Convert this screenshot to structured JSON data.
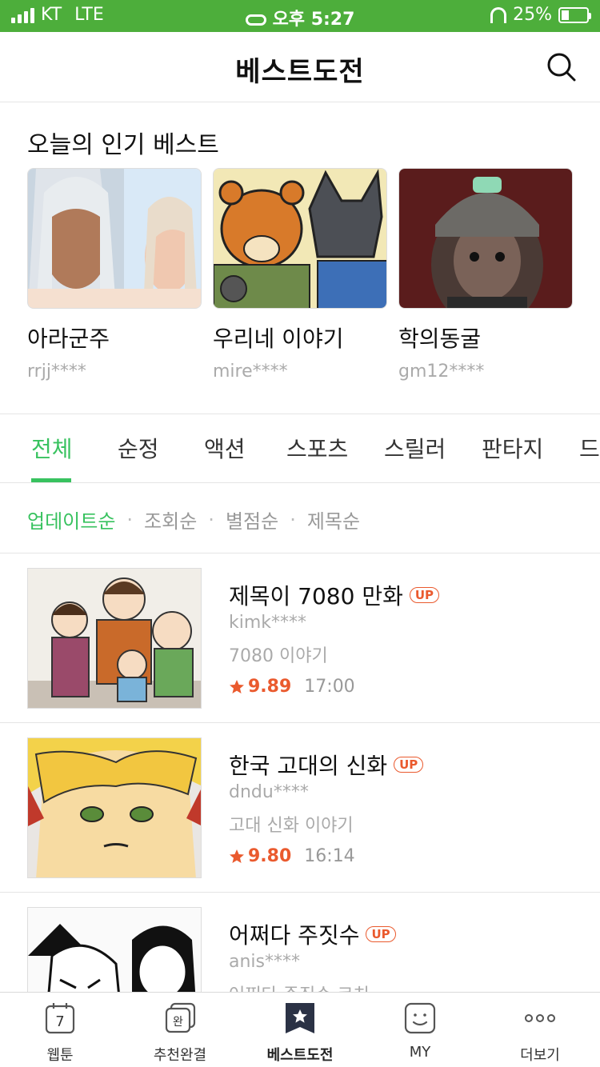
{
  "status": {
    "carrier": "KT",
    "network": "LTE",
    "time": "오후 5:27",
    "battery": "25%"
  },
  "header": {
    "title": "베스트도전"
  },
  "popular": {
    "title": "오늘의 인기 베스트",
    "cards": [
      {
        "name": "아라군주",
        "author": "rrjj****"
      },
      {
        "name": "우리네 이야기",
        "author": "mire****"
      },
      {
        "name": "학의동굴",
        "author": "gm12****"
      }
    ]
  },
  "tabs": [
    "전체",
    "순정",
    "액션",
    "스포츠",
    "스릴러",
    "판타지",
    "드"
  ],
  "sort": {
    "options": [
      "업데이트순",
      "조회순",
      "별점순",
      "제목순"
    ],
    "separator": "·"
  },
  "list": [
    {
      "title": "제목이 7080 만화",
      "badge": "UP",
      "author": "kimk****",
      "desc": "7080 이야기",
      "rating": "9.89",
      "time": "17:00"
    },
    {
      "title": "한국 고대의 신화",
      "badge": "UP",
      "author": "dndu****",
      "desc": "고대 신화 이야기",
      "rating": "9.80",
      "time": "16:14"
    },
    {
      "title": "어쩌다 주짓수",
      "badge": "UP",
      "author": "anis****",
      "desc": "어쩌다 주짓수 코치",
      "rating": "",
      "time": ""
    }
  ],
  "bottom_nav": {
    "items": [
      "웹툰",
      "추천완결",
      "베스트도전",
      "MY",
      "더보기"
    ],
    "webtoon_icon_text": "7",
    "complete_icon_text": "완"
  },
  "colors": {
    "status_bar": "#4dae3b",
    "accent": "#38c25f",
    "rating": "#ea5a2e"
  }
}
